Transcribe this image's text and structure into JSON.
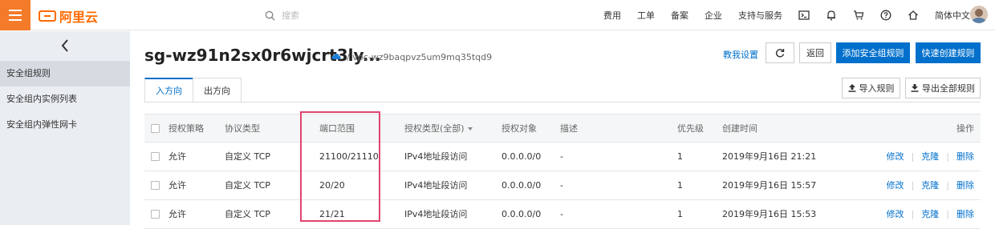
{
  "topbar": {
    "logo_text": "阿里云",
    "search_placeholder": "搜索",
    "nav": [
      "费用",
      "工单",
      "备案",
      "企业",
      "支持与服务"
    ],
    "language": "简体中文",
    "icons": [
      "terminal-icon",
      "bell-icon",
      "cart-icon",
      "help-icon",
      "home-icon"
    ]
  },
  "sidebar": {
    "items": [
      "安全组规则",
      "安全组内实例列表",
      "安全组内弹性网卡"
    ],
    "active_index": 0
  },
  "header": {
    "title": "sg-wz91n2sx0r6wjcrt3ly...",
    "vpc": "/ vpc-wz9baqpvz5um9mq35tqd9",
    "tutorial_link": "教我设置",
    "back_button": "返回",
    "add_rule_button": "添加安全组规则",
    "quick_create_button": "快速创建规则"
  },
  "tabs": {
    "inbound": "入方向",
    "outbound": "出方向",
    "import_button": "导入规则",
    "export_button": "导出全部规则"
  },
  "table": {
    "headers": [
      "授权策略",
      "协议类型",
      "端口范围",
      "授权类型(全部)",
      "授权对象",
      "描述",
      "优先级",
      "创建时间",
      "操作"
    ],
    "rows": [
      {
        "policy": "允许",
        "protocol": "自定义 TCP",
        "port": "21100/21110",
        "auth_type": "IPv4地址段访问",
        "object": "0.0.0.0/0",
        "desc": "-",
        "priority": "1",
        "created": "2019年9月16日 21:21"
      },
      {
        "policy": "允许",
        "protocol": "自定义 TCP",
        "port": "20/20",
        "auth_type": "IPv4地址段访问",
        "object": "0.0.0.0/0",
        "desc": "-",
        "priority": "1",
        "created": "2019年9月16日 15:57"
      },
      {
        "policy": "允许",
        "protocol": "自定义 TCP",
        "port": "21/21",
        "auth_type": "IPv4地址段访问",
        "object": "0.0.0.0/0",
        "desc": "-",
        "priority": "1",
        "created": "2019年9月16日 15:53"
      }
    ],
    "actions": {
      "edit": "修改",
      "clone": "克隆",
      "delete": "删除"
    }
  },
  "colors": {
    "brand": "#f47b2a",
    "primary": "#0070cc",
    "highlight": "#e0456e"
  }
}
